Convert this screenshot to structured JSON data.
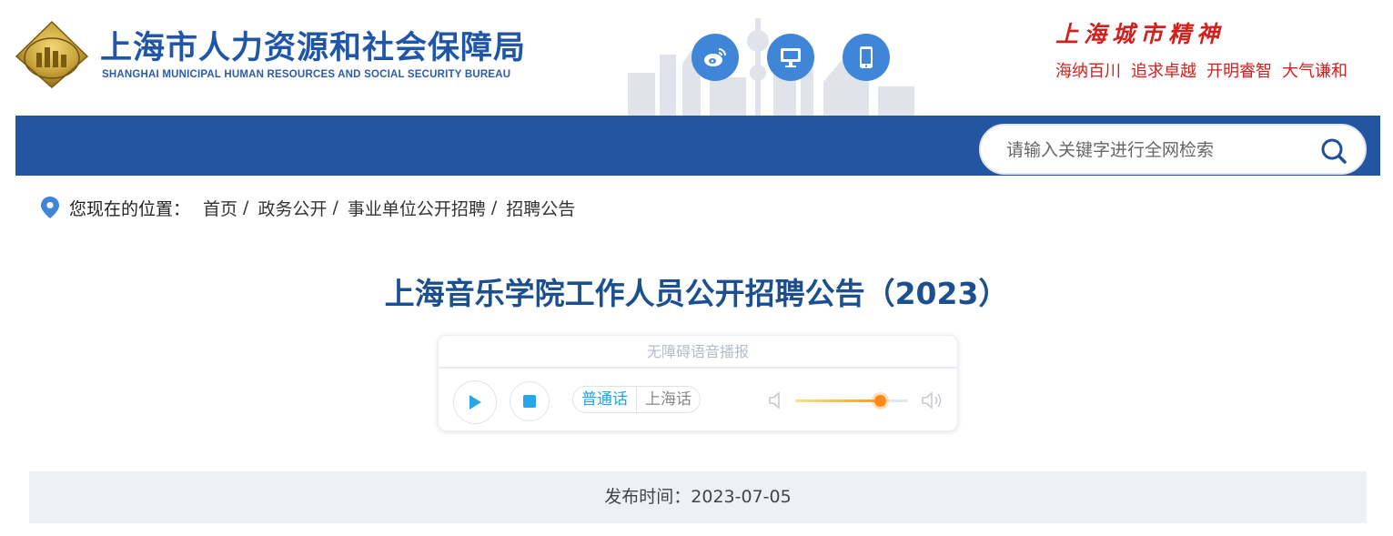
{
  "header": {
    "org_name_cn": "上海市人力资源和社会保障局",
    "org_name_en": "SHANGHAI MUNICIPAL HUMAN RESOURCES AND SOCIAL SECURITY BUREAU",
    "logo_icon": "shanghai-emblem",
    "social_buttons": [
      {
        "name": "weibo",
        "icon": "weibo-icon"
      },
      {
        "name": "desktop",
        "icon": "monitor-icon"
      },
      {
        "name": "mobile",
        "icon": "phone-icon"
      }
    ],
    "spirit_title": "上海城市精神",
    "spirit_mottos": [
      "海纳百川",
      "追求卓越",
      "开明睿智",
      "大气谦和"
    ],
    "colors": {
      "brand_blue": "#2355a0",
      "button_blue": "#3f86d8",
      "spirit_red": "#d2201e"
    }
  },
  "search": {
    "placeholder": "请输入关键字进行全网检索",
    "icon": "search-icon"
  },
  "breadcrumb": {
    "label": "您现在的位置：",
    "items": [
      "首页",
      "政务公开",
      "事业单位公开招聘",
      "招聘公告"
    ],
    "separator": "/"
  },
  "article": {
    "title": "上海音乐学院工作人员公开招聘公告（2023）",
    "publish_label": "发布时间：",
    "publish_date": "2023-07-05"
  },
  "player": {
    "heading": "无障碍语音播报",
    "languages": [
      "普通话",
      "上海话"
    ],
    "selected_language": "普通话",
    "volume": 0.75
  }
}
